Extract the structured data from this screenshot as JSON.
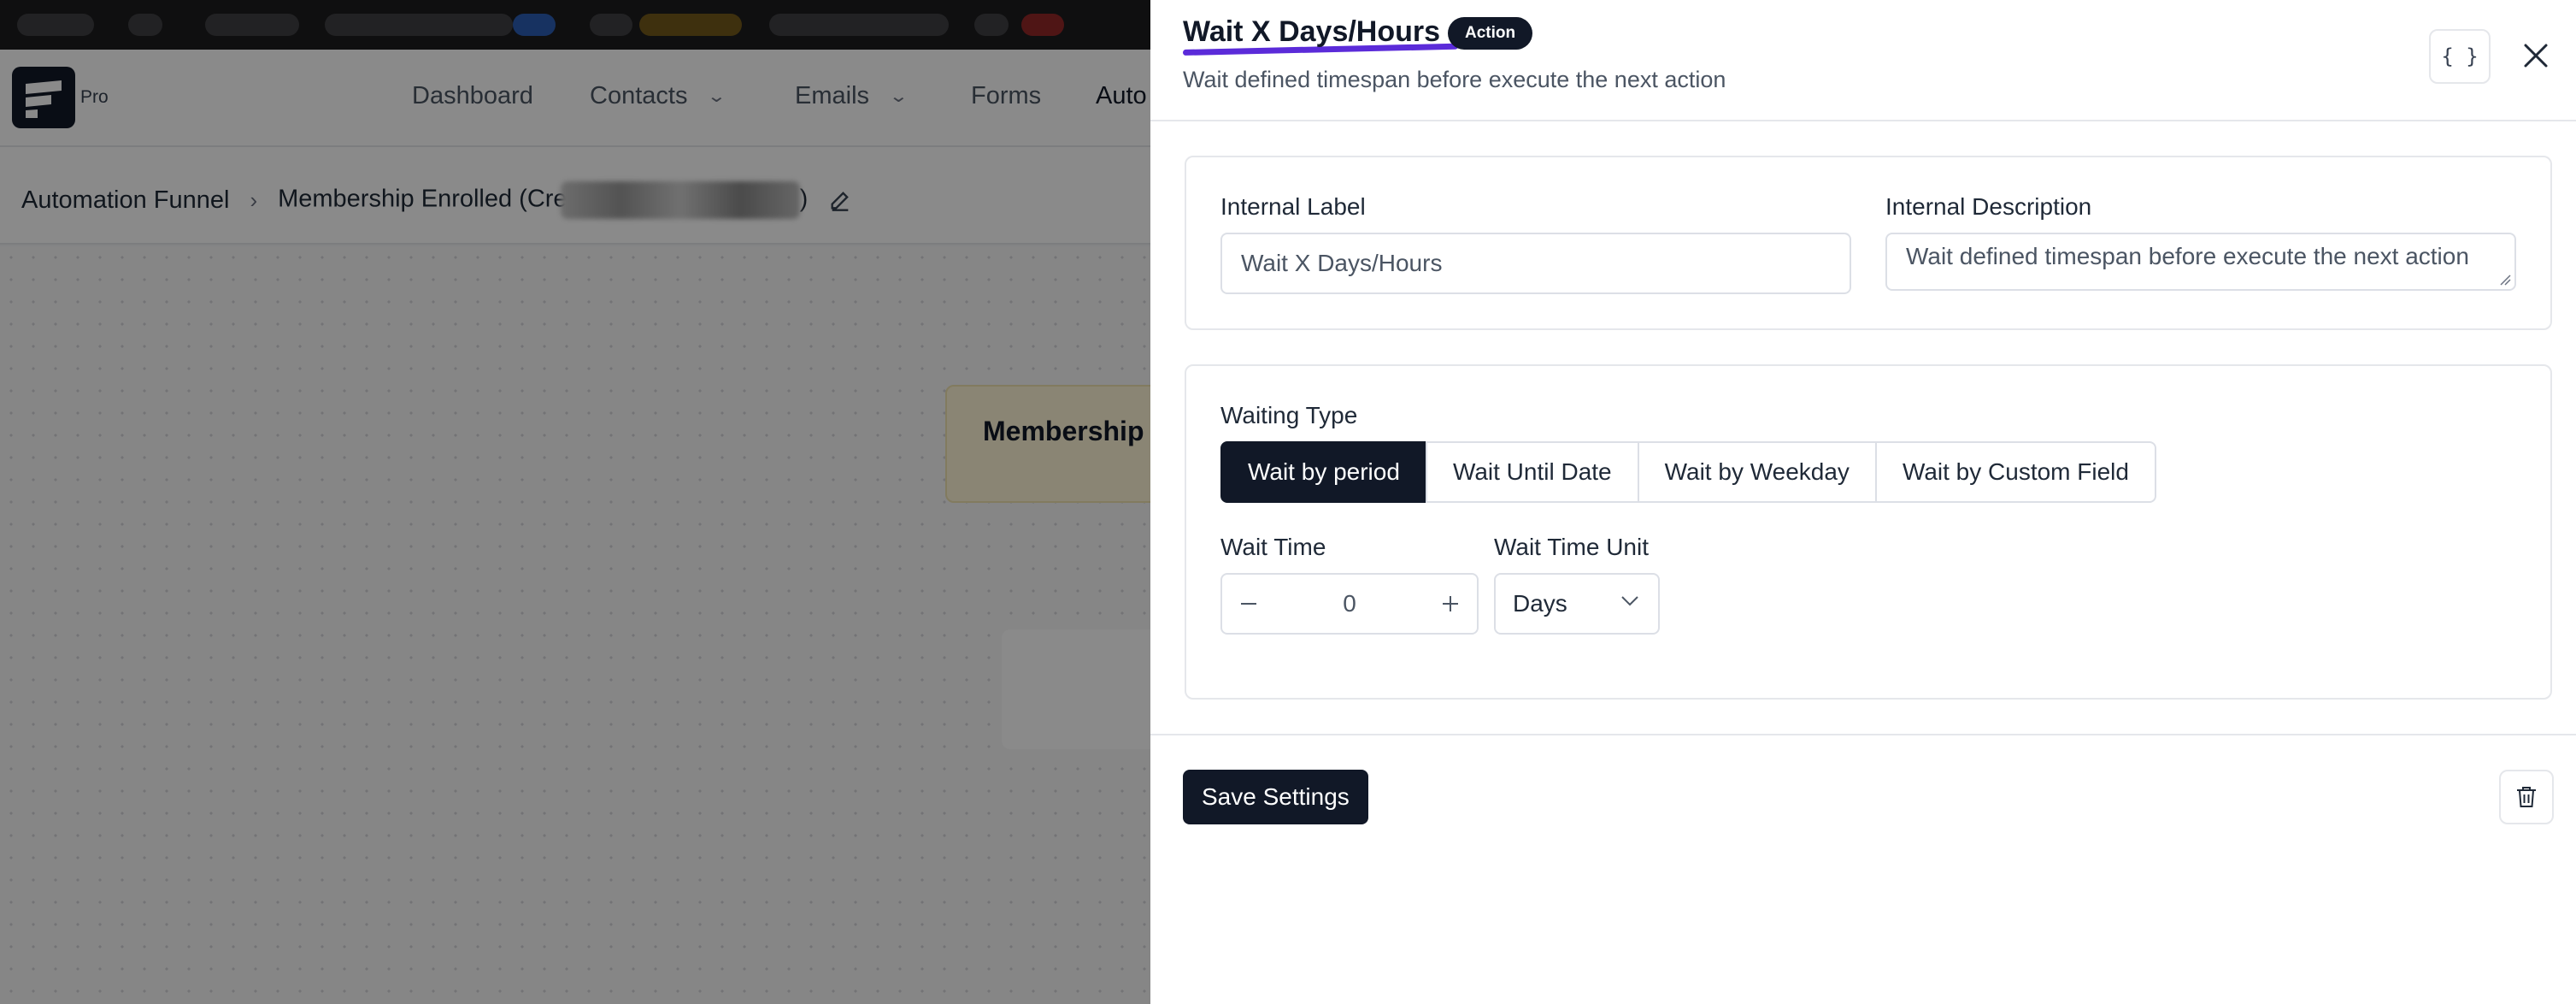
{
  "app": {
    "brand_suffix": "Pro",
    "nav": [
      {
        "label": "Dashboard",
        "has_dropdown": false
      },
      {
        "label": "Contacts",
        "has_dropdown": true
      },
      {
        "label": "Emails",
        "has_dropdown": true
      },
      {
        "label": "Forms",
        "has_dropdown": false
      },
      {
        "label": "Auto",
        "has_dropdown": false
      }
    ],
    "breadcrumb": {
      "root": "Automation Funnel",
      "current": "Membership Enrolled (Cre",
      "trailing": ")"
    },
    "canvas": {
      "trigger_title": "Membership"
    }
  },
  "drawer": {
    "title": "Wait X Days/Hours",
    "badge": "Action",
    "subtitle": "Wait defined timespan before execute the next action",
    "code_button_label": "{ }",
    "internal_label": {
      "label": "Internal Label",
      "value": "Wait X Days/Hours"
    },
    "internal_description": {
      "label": "Internal Description",
      "value": "Wait defined timespan before execute the next action"
    },
    "waiting_type": {
      "label": "Waiting Type",
      "options": [
        "Wait by period",
        "Wait Until Date",
        "Wait by Weekday",
        "Wait by Custom Field"
      ],
      "selected": "Wait by period"
    },
    "wait_time": {
      "label": "Wait Time",
      "value": "0"
    },
    "wait_time_unit": {
      "label": "Wait Time Unit",
      "value": "Days"
    },
    "save_label": "Save Settings"
  },
  "colors": {
    "primary": "#111827",
    "accent_underline": "#5b2bd9",
    "trigger_card": "#fff6d6"
  },
  "icons": {
    "close": "close-icon",
    "trash": "trash-icon",
    "edit": "edit-icon",
    "chevron": "chevron-down-icon"
  }
}
